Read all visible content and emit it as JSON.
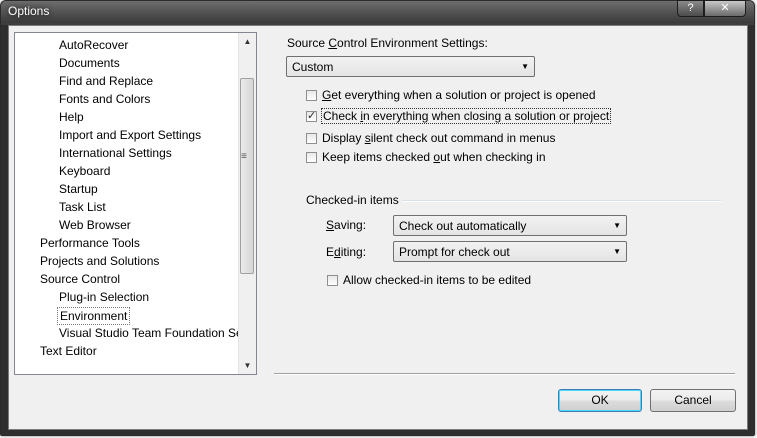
{
  "window": {
    "title": "Options"
  },
  "titlebar": {
    "help_icon": "?",
    "close_icon": "✕"
  },
  "tree": {
    "items": [
      {
        "label": "AutoRecover",
        "level": 2
      },
      {
        "label": "Documents",
        "level": 2
      },
      {
        "label": "Find and Replace",
        "level": 2
      },
      {
        "label": "Fonts and Colors",
        "level": 2
      },
      {
        "label": "Help",
        "level": 2
      },
      {
        "label": "Import and Export Settings",
        "level": 2
      },
      {
        "label": "International Settings",
        "level": 2
      },
      {
        "label": "Keyboard",
        "level": 2
      },
      {
        "label": "Startup",
        "level": 2
      },
      {
        "label": "Task List",
        "level": 2
      },
      {
        "label": "Web Browser",
        "level": 2
      },
      {
        "label": "Performance Tools",
        "level": 1
      },
      {
        "label": "Projects and Solutions",
        "level": 1
      },
      {
        "label": "Source Control",
        "level": 1
      },
      {
        "label": "Plug-in Selection",
        "level": 2
      },
      {
        "label": "Environment",
        "level": 2,
        "selected": true
      },
      {
        "label": "Visual Studio Team Foundation Se",
        "level": 2
      },
      {
        "label": "Text Editor",
        "level": 1
      }
    ],
    "scroll_up_icon": "▲",
    "scroll_down_icon": "▼",
    "scroll_grip_icon": "≡"
  },
  "settings": {
    "env_label_pre": "Source ",
    "env_label_ul": "C",
    "env_label_post": "ontrol Environment Settings:",
    "env_value": "Custom",
    "dropdown_icon": "▼",
    "checkboxes": [
      {
        "ul": "G",
        "rest": "et everything when a solution or project is opened",
        "checked": false,
        "mark": ""
      },
      {
        "pre": "Check ",
        "ul": "i",
        "rest": "n everything when closing a solution or project",
        "checked": true,
        "mark": "✓"
      },
      {
        "pre": "Display ",
        "ul": "s",
        "rest": "ilent check out command in menus",
        "checked": false,
        "mark": ""
      },
      {
        "pre": "Keep items checked ",
        "ul": "o",
        "rest": "ut when checking in",
        "checked": false,
        "mark": ""
      }
    ]
  },
  "checked_in": {
    "group_title": "Checked-in items",
    "saving_label_ul": "S",
    "saving_label_rest": "aving:",
    "saving_value": "Check out automatically",
    "editing_label_pre": "E",
    "editing_label_ul": "d",
    "editing_label_rest": "iting:",
    "editing_value": "Prompt for check out",
    "allow_label": "Allow checked-in items to be edited",
    "allow_checked": false
  },
  "buttons": {
    "ok": "OK",
    "cancel": "Cancel"
  }
}
